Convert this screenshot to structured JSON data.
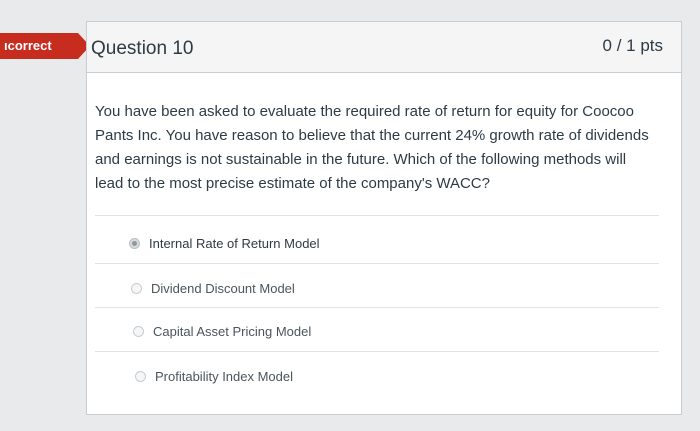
{
  "badge": {
    "label": "ıcorrect"
  },
  "question": {
    "title": "Question 10",
    "points": "0 / 1 pts",
    "text": "You have been asked to evaluate the required rate of return for equity for Coocoo Pants Inc. You have reason to believe that the current 24% growth rate of dividends and earnings is not sustainable in the future. Which of the following methods will lead to the most precise estimate of the company's WACC?"
  },
  "answers": [
    {
      "label": "Internal Rate of Return Model",
      "selected": true
    },
    {
      "label": "Dividend Discount Model",
      "selected": false
    },
    {
      "label": "Capital Asset Pricing Model",
      "selected": false
    },
    {
      "label": "Profitability Index Model",
      "selected": false
    }
  ],
  "colors": {
    "incorrect_badge": "#c62d1f",
    "header_bg": "#f5f5f5"
  }
}
